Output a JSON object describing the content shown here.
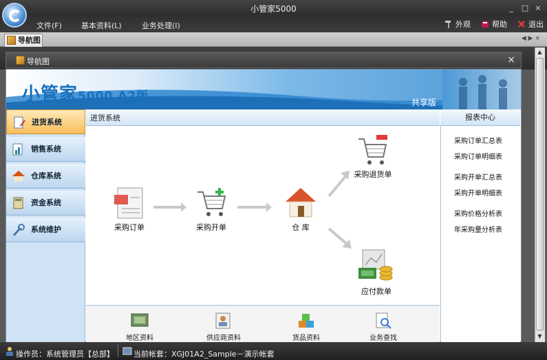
{
  "window": {
    "title": "小管家5000",
    "controls": [
      "_",
      "□",
      "×"
    ]
  },
  "menu": [
    "文件(F)",
    "基本资料(L)",
    "业务处理(I)"
  ],
  "right_menu": [
    {
      "label": "外观",
      "icon": "hammer-icon"
    },
    {
      "label": "帮助",
      "icon": "help-book-icon"
    },
    {
      "label": "退出",
      "icon": "exit-icon"
    }
  ],
  "tab": {
    "label": "导航图"
  },
  "panel": {
    "title": "导航图",
    "close": "×"
  },
  "banner": {
    "title": "小管家",
    "version": "5000 A2版",
    "edition": "共享版"
  },
  "nav": [
    {
      "label": "进货系统",
      "active": true
    },
    {
      "label": "销售系统"
    },
    {
      "label": "仓库系统"
    },
    {
      "label": "资金系统"
    },
    {
      "label": "系统维护"
    }
  ],
  "center": {
    "header": "进货系统"
  },
  "flow": {
    "order": "采购订单",
    "invoice": "采购开单",
    "warehouse": "仓 库",
    "return": "采购退货单",
    "payable": "应付款单"
  },
  "bottom": [
    "地区资料",
    "供应商资料",
    "货品资料",
    "业务查找"
  ],
  "reports": {
    "header": "报表中心",
    "items": [
      "采购订单汇总表",
      "采购订单明细表",
      "采购开单汇总表",
      "采购开单明细表",
      "采购价格分析表",
      "年采购量分析表"
    ]
  },
  "status": {
    "operator": "操作员：系统管理员【总部】",
    "account": "当前帐套：XGJ01A2_Sample－演示帐套"
  },
  "colors": {
    "accent": "#1770bc",
    "nav_active": "#f9be5c",
    "chrome": "#3a3a3a"
  }
}
